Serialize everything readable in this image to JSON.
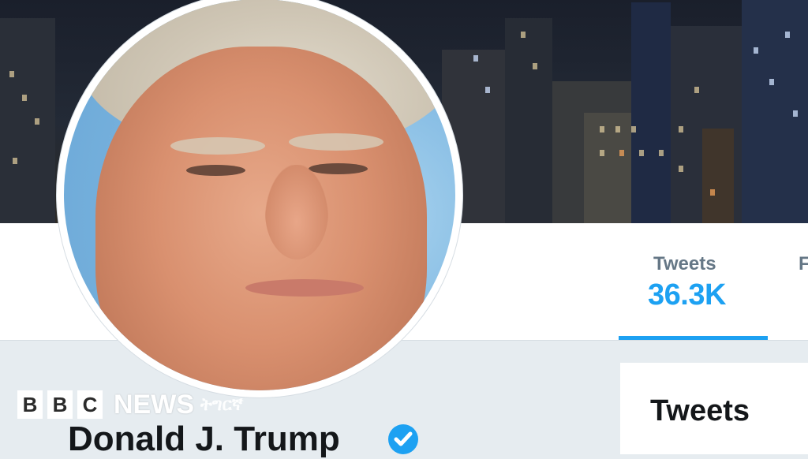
{
  "profile": {
    "name": "Donald J. Trump",
    "verified_icon": "verified-badge-icon",
    "avatar": "profile-photo"
  },
  "nav": {
    "tabs": [
      {
        "label": "Tweets",
        "value": "36.3K",
        "active": true
      },
      {
        "label": "F",
        "value": ""
      }
    ]
  },
  "timeline": {
    "heading": "Tweets"
  },
  "watermark": {
    "letters": [
      "B",
      "B",
      "C"
    ],
    "news": "NEWS",
    "language": "ትግርኛ"
  },
  "colors": {
    "accent": "#1da1f2",
    "text": "#14171a",
    "muted": "#657786",
    "background": "#e6ecf0"
  }
}
